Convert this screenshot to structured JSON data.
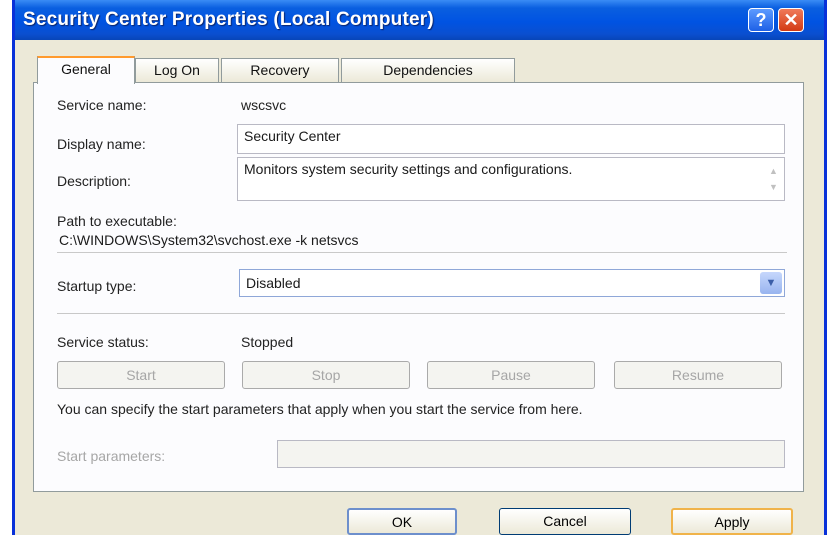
{
  "window": {
    "title": "Security Center Properties (Local Computer)",
    "help_label": "?",
    "close_label": "✕"
  },
  "tabs": [
    {
      "label": "General",
      "active": true
    },
    {
      "label": "Log On",
      "active": false
    },
    {
      "label": "Recovery",
      "active": false
    },
    {
      "label": "Dependencies",
      "active": false
    }
  ],
  "general": {
    "service_name_label": "Service name:",
    "service_name_value": "wscsvc",
    "display_name_label": "Display name:",
    "display_name_value": "Security Center",
    "description_label": "Description:",
    "description_value": "Monitors system security settings and configurations.",
    "path_label": "Path to executable:",
    "path_value": "C:\\WINDOWS\\System32\\svchost.exe -k netsvcs",
    "startup_type_label": "Startup type:",
    "startup_type_value": "Disabled",
    "service_status_label": "Service status:",
    "service_status_value": "Stopped",
    "buttons": {
      "start": "Start",
      "stop": "Stop",
      "pause": "Pause",
      "resume": "Resume"
    },
    "hint_text": "You can specify the start parameters that apply when you start the service from here.",
    "start_params_label": "Start parameters:",
    "start_params_value": ""
  },
  "footer": {
    "ok": "OK",
    "cancel": "Cancel",
    "apply": "Apply"
  },
  "colors": {
    "titlebar": "#0053e2",
    "dialog_bg": "#ece9d8",
    "active_tab_accent": "#ff9a2e",
    "close_button": "#d23a14"
  },
  "icons": {
    "dropdown": "chevron-down-icon",
    "help": "help-icon",
    "close": "close-icon"
  }
}
